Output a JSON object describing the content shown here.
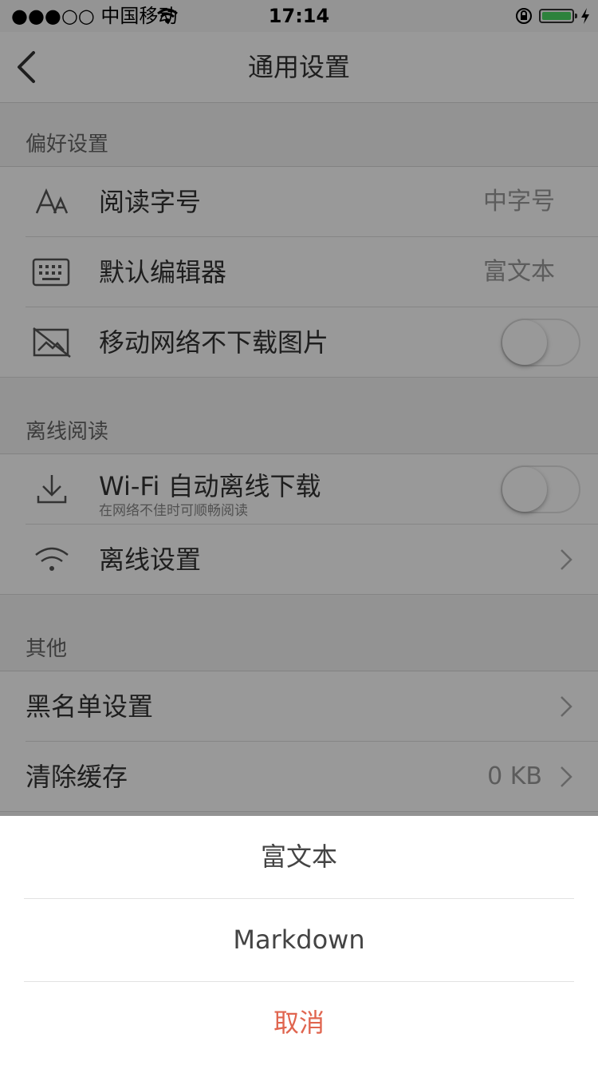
{
  "status_bar": {
    "carrier": "●●●○○ 中国移动",
    "time": "17:14"
  },
  "nav": {
    "title": "通用设置"
  },
  "sections": {
    "preferences": {
      "header": "偏好设置",
      "font_size": {
        "label": "阅读字号",
        "value": "中字号"
      },
      "editor": {
        "label": "默认编辑器",
        "value": "富文本"
      },
      "no_images": {
        "label": "移动网络不下载图片",
        "enabled": false
      }
    },
    "offline": {
      "header": "离线阅读",
      "wifi_download": {
        "label": "Wi-Fi 自动离线下载",
        "sub": "在网络不佳时可顺畅阅读",
        "enabled": false
      },
      "offline_settings": {
        "label": "离线设置"
      }
    },
    "other": {
      "header": "其他",
      "blacklist": {
        "label": "黑名单设置"
      },
      "clear_cache": {
        "label": "清除缓存",
        "value": "0 KB"
      }
    }
  },
  "action_sheet": {
    "option_rich_text": "富文本",
    "option_markdown": "Markdown",
    "cancel": "取消"
  },
  "colors": {
    "cancel": "#e0654f",
    "toggle_off": "#ffffff",
    "overlay": "rgba(0,0,0,0.40)"
  }
}
